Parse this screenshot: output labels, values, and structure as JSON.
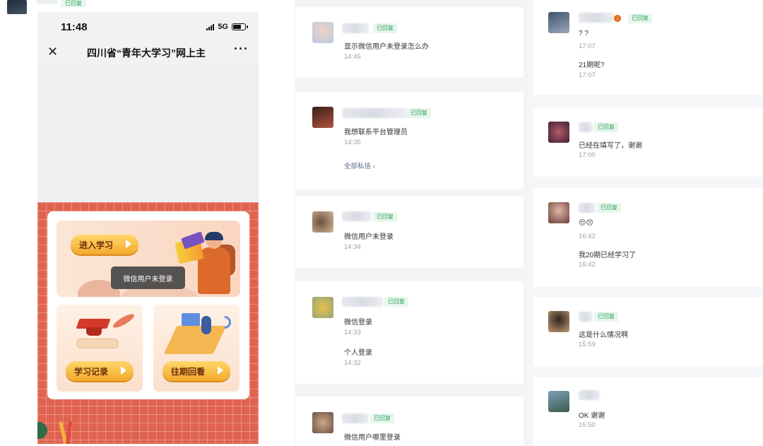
{
  "phone": {
    "status_time": "11:48",
    "status_network": "5G",
    "page_title": "四川省“青年大学习”网上主",
    "close_icon": "close-icon",
    "more_icon": "more-icon",
    "btn_enter_study": "进入学习",
    "toast": "微信用户未登录",
    "btn_study_record": "学习记录",
    "btn_past_review": "往期回看"
  },
  "top_strip": {
    "tag": "已回复"
  },
  "middle_column": {
    "cards": [
      {
        "tag": "已回复",
        "messages": [
          {
            "text": "显示微信用户未登录怎么办",
            "time": "14:45"
          }
        ]
      },
      {
        "tag": "已回复",
        "messages": [
          {
            "text": "我想联系平台管理员",
            "time": "14:35"
          }
        ],
        "link": "全部私信 ›"
      },
      {
        "tag": "已回复",
        "messages": [
          {
            "text": "微信用户未登录",
            "time": "14:34"
          }
        ]
      },
      {
        "tag": "已回复",
        "messages": [
          {
            "text": "微信登录",
            "time": "14:33"
          },
          {
            "text": "个人登录",
            "time": "14:32"
          }
        ]
      },
      {
        "tag": "已回复",
        "messages": [
          {
            "text": "微信用户哪里登录",
            "time": ""
          }
        ]
      }
    ]
  },
  "right_column": {
    "cards": [
      {
        "tag": "已回复",
        "messages": [
          {
            "text": "? ?",
            "time": "17:07"
          },
          {
            "text": "21期呢?",
            "time": "17:07"
          }
        ]
      },
      {
        "tag": "已回复",
        "messages": [
          {
            "text": "已经在填写了，谢谢",
            "time": "17:00"
          }
        ]
      },
      {
        "tag": "已回复",
        "messages": [
          {
            "text": "😔😔",
            "time": "16:42"
          },
          {
            "text": "我20期已经学习了",
            "time": "16:42"
          }
        ]
      },
      {
        "tag": "已回复",
        "messages": [
          {
            "text": "这是什么情况啊",
            "time": "15:59"
          }
        ]
      },
      {
        "tag": "已回复",
        "messages": [
          {
            "text": "OK 谢谢",
            "time": "15:50"
          }
        ]
      }
    ]
  },
  "colors": {
    "tag_bg": "#e7f6ed",
    "tag_text": "#2ea35a",
    "grid_red": "#e0634f",
    "button_gold": "#f3a92c"
  }
}
